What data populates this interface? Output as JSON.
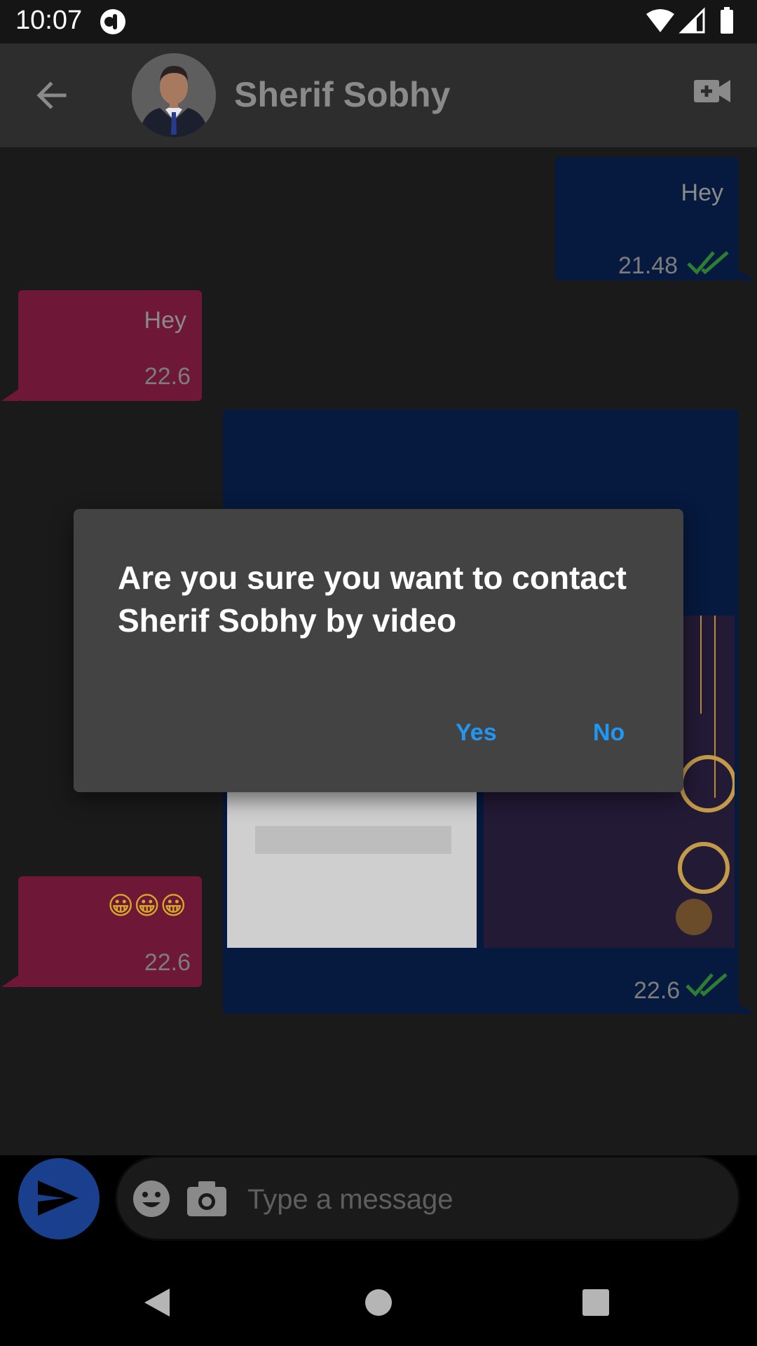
{
  "status_bar": {
    "time": "10:07"
  },
  "header": {
    "contact_name": "Sherif Sobhy"
  },
  "messages": [
    {
      "direction": "outgoing",
      "text": "Hey",
      "time": "21.48",
      "read": true
    },
    {
      "direction": "incoming",
      "text": "Hey",
      "time": "22.6"
    },
    {
      "direction": "outgoing",
      "type": "images",
      "time": "22.6",
      "read": true
    },
    {
      "direction": "incoming",
      "text": "😀😀😀",
      "time": "22.6"
    }
  ],
  "composer": {
    "placeholder": "Type a message"
  },
  "dialog": {
    "message": "Are you sure you want to contact Sherif Sobhy by video",
    "yes_label": "Yes",
    "no_label": "No"
  },
  "icons": {
    "back": "arrow-back-icon",
    "video": "video-call-icon",
    "emoji": "emoji-icon",
    "camera": "camera-icon",
    "send": "send-icon",
    "read_receipt": "double-check-icon"
  },
  "colors": {
    "outgoing_bubble": "#06193e",
    "incoming_bubble": "#6e1737",
    "accent": "#2196f3",
    "read_check": "#2e7d32"
  }
}
